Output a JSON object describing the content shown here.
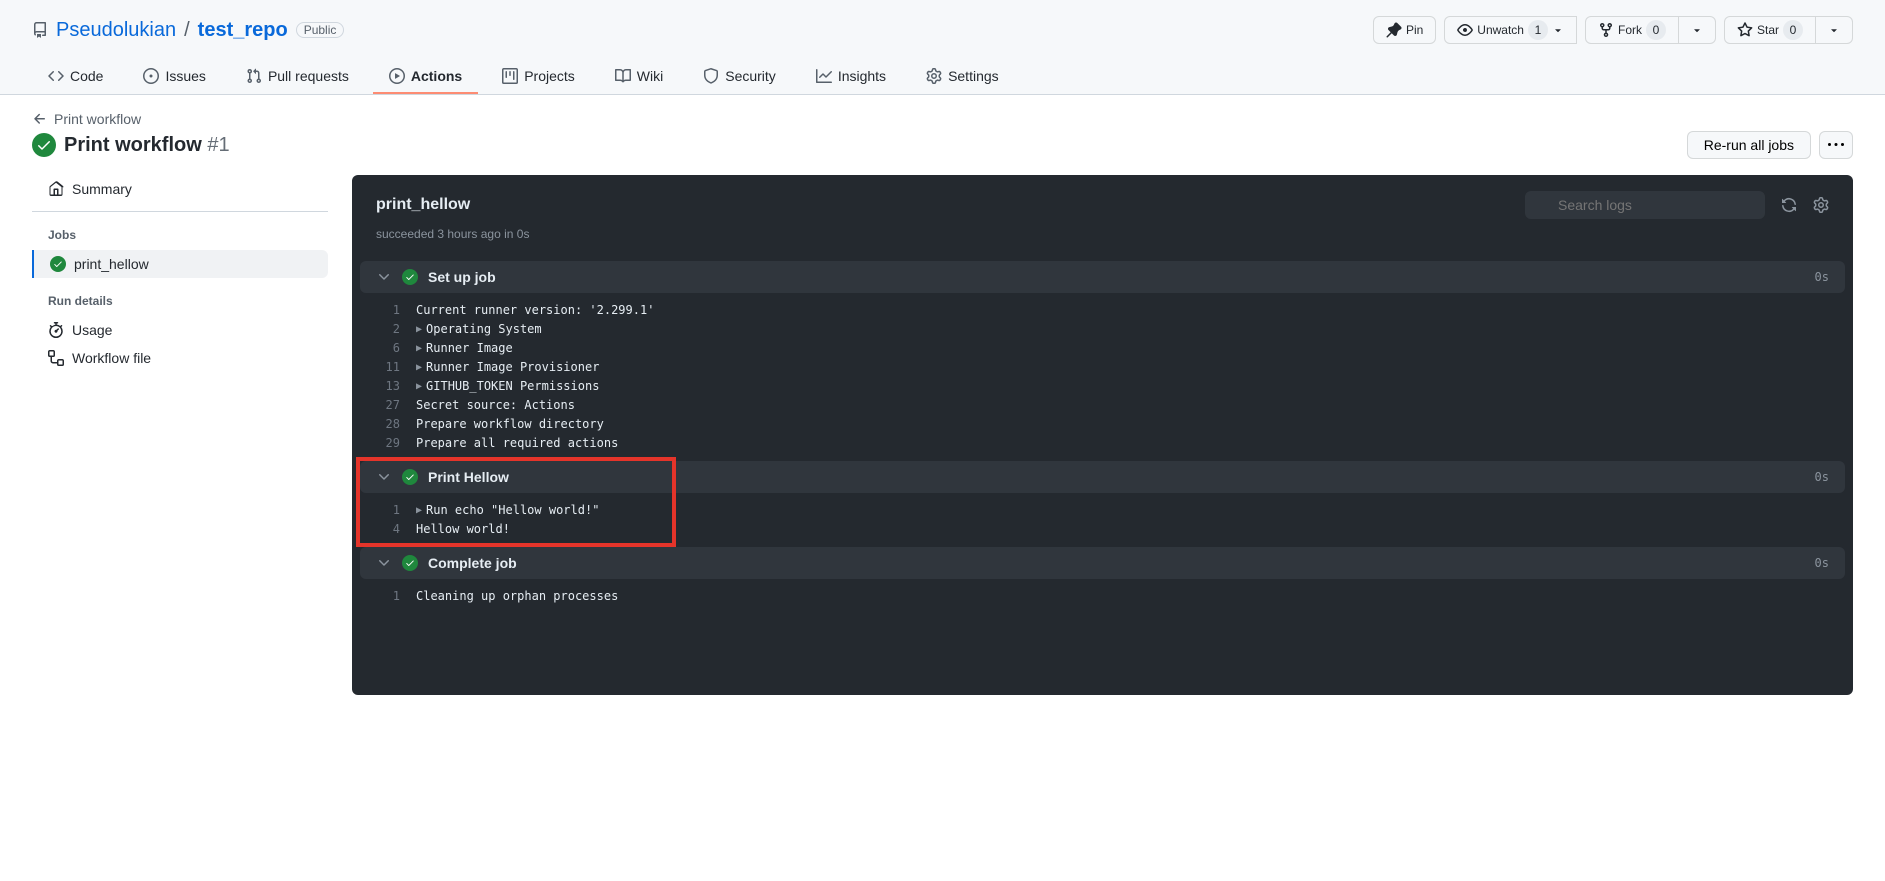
{
  "repo": {
    "owner": "Pseudolukian",
    "name": "test_repo",
    "visibility": "Public"
  },
  "header_actions": {
    "pin": "Pin",
    "unwatch": "Unwatch",
    "unwatch_count": "1",
    "fork": "Fork",
    "fork_count": "0",
    "star": "Star",
    "star_count": "0"
  },
  "nav": {
    "code": "Code",
    "issues": "Issues",
    "pulls": "Pull requests",
    "actions": "Actions",
    "projects": "Projects",
    "wiki": "Wiki",
    "security": "Security",
    "insights": "Insights",
    "settings": "Settings"
  },
  "breadcrumb_back": "Print workflow",
  "workflow": {
    "title": "Print workflow",
    "number": "#1"
  },
  "header_buttons": {
    "rerun": "Re-run all jobs"
  },
  "sidebar": {
    "summary": "Summary",
    "jobs_heading": "Jobs",
    "job_name": "print_hellow",
    "run_details_heading": "Run details",
    "usage": "Usage",
    "workflow_file": "Workflow file"
  },
  "log": {
    "job_title": "print_hellow",
    "job_status": "succeeded 3 hours ago in 0s",
    "search_placeholder": "Search logs",
    "steps": [
      {
        "title": "Set up job",
        "duration": "0s",
        "lines": [
          {
            "n": "1",
            "caret": false,
            "t": "Current runner version: '2.299.1'"
          },
          {
            "n": "2",
            "caret": true,
            "t": "Operating System"
          },
          {
            "n": "6",
            "caret": true,
            "t": "Runner Image"
          },
          {
            "n": "11",
            "caret": true,
            "t": "Runner Image Provisioner"
          },
          {
            "n": "13",
            "caret": true,
            "t": "GITHUB_TOKEN Permissions"
          },
          {
            "n": "27",
            "caret": false,
            "t": "Secret source: Actions"
          },
          {
            "n": "28",
            "caret": false,
            "t": "Prepare workflow directory"
          },
          {
            "n": "29",
            "caret": false,
            "t": "Prepare all required actions"
          }
        ]
      },
      {
        "title": "Print Hellow",
        "duration": "0s",
        "lines": [
          {
            "n": "1",
            "caret": true,
            "t": "Run echo \"Hellow world!\""
          },
          {
            "n": "4",
            "caret": false,
            "t": "Hellow world!"
          }
        ]
      },
      {
        "title": "Complete job",
        "duration": "0s",
        "lines": [
          {
            "n": "1",
            "caret": false,
            "t": "Cleaning up orphan processes"
          }
        ]
      }
    ]
  }
}
